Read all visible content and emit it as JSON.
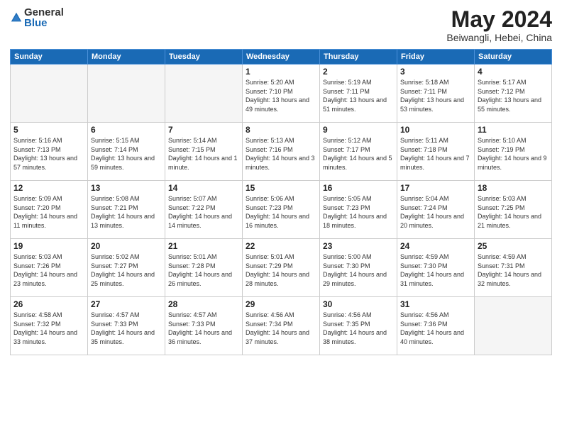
{
  "header": {
    "logo_general": "General",
    "logo_blue": "Blue",
    "month": "May 2024",
    "location": "Beiwangli, Hebei, China"
  },
  "weekdays": [
    "Sunday",
    "Monday",
    "Tuesday",
    "Wednesday",
    "Thursday",
    "Friday",
    "Saturday"
  ],
  "weeks": [
    [
      {
        "day": "",
        "info": ""
      },
      {
        "day": "",
        "info": ""
      },
      {
        "day": "",
        "info": ""
      },
      {
        "day": "1",
        "info": "Sunrise: 5:20 AM\nSunset: 7:10 PM\nDaylight: 13 hours\nand 49 minutes."
      },
      {
        "day": "2",
        "info": "Sunrise: 5:19 AM\nSunset: 7:11 PM\nDaylight: 13 hours\nand 51 minutes."
      },
      {
        "day": "3",
        "info": "Sunrise: 5:18 AM\nSunset: 7:11 PM\nDaylight: 13 hours\nand 53 minutes."
      },
      {
        "day": "4",
        "info": "Sunrise: 5:17 AM\nSunset: 7:12 PM\nDaylight: 13 hours\nand 55 minutes."
      }
    ],
    [
      {
        "day": "5",
        "info": "Sunrise: 5:16 AM\nSunset: 7:13 PM\nDaylight: 13 hours\nand 57 minutes."
      },
      {
        "day": "6",
        "info": "Sunrise: 5:15 AM\nSunset: 7:14 PM\nDaylight: 13 hours\nand 59 minutes."
      },
      {
        "day": "7",
        "info": "Sunrise: 5:14 AM\nSunset: 7:15 PM\nDaylight: 14 hours\nand 1 minute."
      },
      {
        "day": "8",
        "info": "Sunrise: 5:13 AM\nSunset: 7:16 PM\nDaylight: 14 hours\nand 3 minutes."
      },
      {
        "day": "9",
        "info": "Sunrise: 5:12 AM\nSunset: 7:17 PM\nDaylight: 14 hours\nand 5 minutes."
      },
      {
        "day": "10",
        "info": "Sunrise: 5:11 AM\nSunset: 7:18 PM\nDaylight: 14 hours\nand 7 minutes."
      },
      {
        "day": "11",
        "info": "Sunrise: 5:10 AM\nSunset: 7:19 PM\nDaylight: 14 hours\nand 9 minutes."
      }
    ],
    [
      {
        "day": "12",
        "info": "Sunrise: 5:09 AM\nSunset: 7:20 PM\nDaylight: 14 hours\nand 11 minutes."
      },
      {
        "day": "13",
        "info": "Sunrise: 5:08 AM\nSunset: 7:21 PM\nDaylight: 14 hours\nand 13 minutes."
      },
      {
        "day": "14",
        "info": "Sunrise: 5:07 AM\nSunset: 7:22 PM\nDaylight: 14 hours\nand 14 minutes."
      },
      {
        "day": "15",
        "info": "Sunrise: 5:06 AM\nSunset: 7:23 PM\nDaylight: 14 hours\nand 16 minutes."
      },
      {
        "day": "16",
        "info": "Sunrise: 5:05 AM\nSunset: 7:23 PM\nDaylight: 14 hours\nand 18 minutes."
      },
      {
        "day": "17",
        "info": "Sunrise: 5:04 AM\nSunset: 7:24 PM\nDaylight: 14 hours\nand 20 minutes."
      },
      {
        "day": "18",
        "info": "Sunrise: 5:03 AM\nSunset: 7:25 PM\nDaylight: 14 hours\nand 21 minutes."
      }
    ],
    [
      {
        "day": "19",
        "info": "Sunrise: 5:03 AM\nSunset: 7:26 PM\nDaylight: 14 hours\nand 23 minutes."
      },
      {
        "day": "20",
        "info": "Sunrise: 5:02 AM\nSunset: 7:27 PM\nDaylight: 14 hours\nand 25 minutes."
      },
      {
        "day": "21",
        "info": "Sunrise: 5:01 AM\nSunset: 7:28 PM\nDaylight: 14 hours\nand 26 minutes."
      },
      {
        "day": "22",
        "info": "Sunrise: 5:01 AM\nSunset: 7:29 PM\nDaylight: 14 hours\nand 28 minutes."
      },
      {
        "day": "23",
        "info": "Sunrise: 5:00 AM\nSunset: 7:30 PM\nDaylight: 14 hours\nand 29 minutes."
      },
      {
        "day": "24",
        "info": "Sunrise: 4:59 AM\nSunset: 7:30 PM\nDaylight: 14 hours\nand 31 minutes."
      },
      {
        "day": "25",
        "info": "Sunrise: 4:59 AM\nSunset: 7:31 PM\nDaylight: 14 hours\nand 32 minutes."
      }
    ],
    [
      {
        "day": "26",
        "info": "Sunrise: 4:58 AM\nSunset: 7:32 PM\nDaylight: 14 hours\nand 33 minutes."
      },
      {
        "day": "27",
        "info": "Sunrise: 4:57 AM\nSunset: 7:33 PM\nDaylight: 14 hours\nand 35 minutes."
      },
      {
        "day": "28",
        "info": "Sunrise: 4:57 AM\nSunset: 7:33 PM\nDaylight: 14 hours\nand 36 minutes."
      },
      {
        "day": "29",
        "info": "Sunrise: 4:56 AM\nSunset: 7:34 PM\nDaylight: 14 hours\nand 37 minutes."
      },
      {
        "day": "30",
        "info": "Sunrise: 4:56 AM\nSunset: 7:35 PM\nDaylight: 14 hours\nand 38 minutes."
      },
      {
        "day": "31",
        "info": "Sunrise: 4:56 AM\nSunset: 7:36 PM\nDaylight: 14 hours\nand 40 minutes."
      },
      {
        "day": "",
        "info": ""
      }
    ]
  ]
}
